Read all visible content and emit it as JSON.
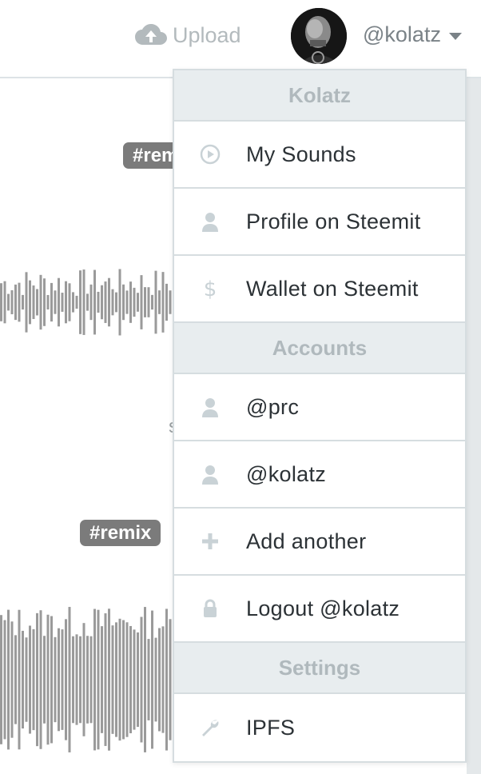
{
  "header": {
    "upload_label": "Upload",
    "username": "@kolatz"
  },
  "background": {
    "tag_top": "#remix",
    "tag_bottom": "#remix",
    "stray_char": "s"
  },
  "dropdown": {
    "sections": [
      {
        "title": "Kolatz",
        "items": [
          {
            "label": "My Sounds",
            "icon": "play-circle-icon"
          },
          {
            "label": "Profile on Steemit",
            "icon": "user-icon"
          },
          {
            "label": "Wallet on Steemit",
            "icon": "dollar-icon"
          }
        ]
      },
      {
        "title": "Accounts",
        "items": [
          {
            "label": "@prc",
            "icon": "user-icon"
          },
          {
            "label": "@kolatz",
            "icon": "user-icon"
          },
          {
            "label": "Add another",
            "icon": "plus-icon"
          },
          {
            "label": "Logout @kolatz",
            "icon": "lock-icon"
          }
        ]
      },
      {
        "title": "Settings",
        "items": [
          {
            "label": "IPFS",
            "icon": "wrench-icon"
          }
        ]
      }
    ]
  },
  "colors": {
    "tag_bg": "#7b7b7b",
    "section_bg": "#e8edef",
    "icon": "#c9d2d6",
    "text": "#2c3236"
  }
}
